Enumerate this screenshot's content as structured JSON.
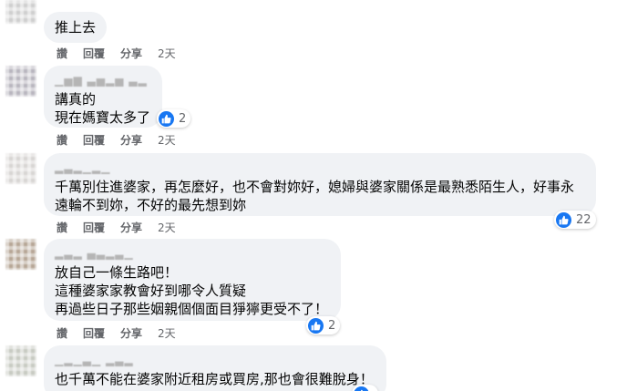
{
  "comments": [
    {
      "author": "",
      "lines": [
        "推上去"
      ],
      "reactions": null,
      "actions": {
        "like": "讚",
        "reply": "回覆",
        "share": "分享",
        "time": "2天"
      }
    },
    {
      "author": "▁▅▆ ▃▅▂▅ ▃▂",
      "lines": [
        "講真的",
        "現在媽寶太多了"
      ],
      "reactions": "2",
      "actions": {
        "like": "讚",
        "reply": "回覆",
        "share": "分享",
        "time": "2天"
      }
    },
    {
      "author": "▂▃▂▁▂▁",
      "lines": [
        "千萬別住進婆家，再怎麼好，也不會對妳好，媳婦與婆家關係是最熟悉陌生人，好事永",
        "遠輪不到妳，不好的最先想到妳"
      ],
      "reactions": "22",
      "actions": {
        "like": "讚",
        "reply": "回覆",
        "share": "分享",
        "time": "2天"
      }
    },
    {
      "author": "▂▃▂ ▄▃▂▃▁",
      "lines": [
        "放自己一條生路吧！",
        "這種婆家家教會好到哪令人質疑",
        "再過些日子那些姻親個個面目猙獰更受不了！"
      ],
      "reactions": "2",
      "actions": {
        "like": "讚",
        "reply": "回覆",
        "share": "分享",
        "time": "2天"
      }
    },
    {
      "author": "▁▂▁▃▁ ▂▃▂",
      "lines": [
        "也千萬不能在婆家附近租房或買房,那也會很難脫身！"
      ],
      "reactions": "",
      "actions": null
    }
  ]
}
